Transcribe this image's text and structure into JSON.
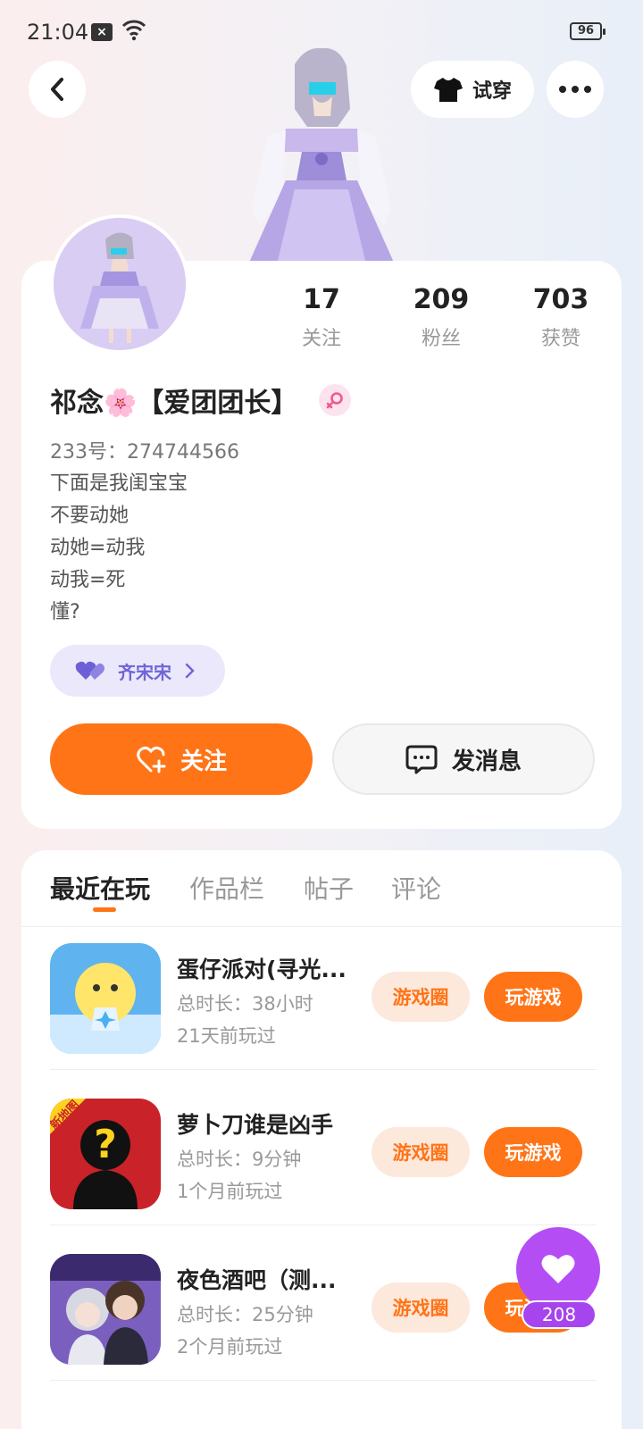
{
  "status": {
    "time": "21:04",
    "battery": "96"
  },
  "header": {
    "tryon_label": "试穿"
  },
  "profile": {
    "stats": [
      {
        "value": "17",
        "label": "关注"
      },
      {
        "value": "209",
        "label": "粉丝"
      },
      {
        "value": "703",
        "label": "获赞"
      }
    ],
    "nickname": "祁念🌸【爱团团长】",
    "uid": "233号：274744566",
    "bio": [
      "下面是我闺宝宝",
      "不要动她",
      "动她=动我",
      "动我=死",
      "懂?"
    ],
    "bond_name": "齐宋宋",
    "follow_label": "关注",
    "message_label": "发消息"
  },
  "tabs": [
    "最近在玩",
    "作品栏",
    "帖子",
    "评论"
  ],
  "games": [
    {
      "title": "蛋仔派对(寻光...",
      "duration": "总时长：38小时",
      "last_played": "21天前玩过",
      "circle_label": "游戏圈",
      "play_label": "玩游戏"
    },
    {
      "title": "萝卜刀谁是凶手",
      "duration": "总时长：9分钟",
      "last_played": "1个月前玩过",
      "circle_label": "游戏圈",
      "play_label": "玩游戏",
      "icon_badge": "新地图"
    },
    {
      "title": "夜色酒吧（测...",
      "duration": "总时长：25分钟",
      "last_played": "2个月前玩过",
      "circle_label": "游戏圈",
      "play_label": "玩游戏"
    }
  ],
  "floating_like": {
    "count": "208"
  },
  "colors": {
    "accent": "#ff7417",
    "bond": "#7064d8",
    "like": "#b54df5"
  }
}
